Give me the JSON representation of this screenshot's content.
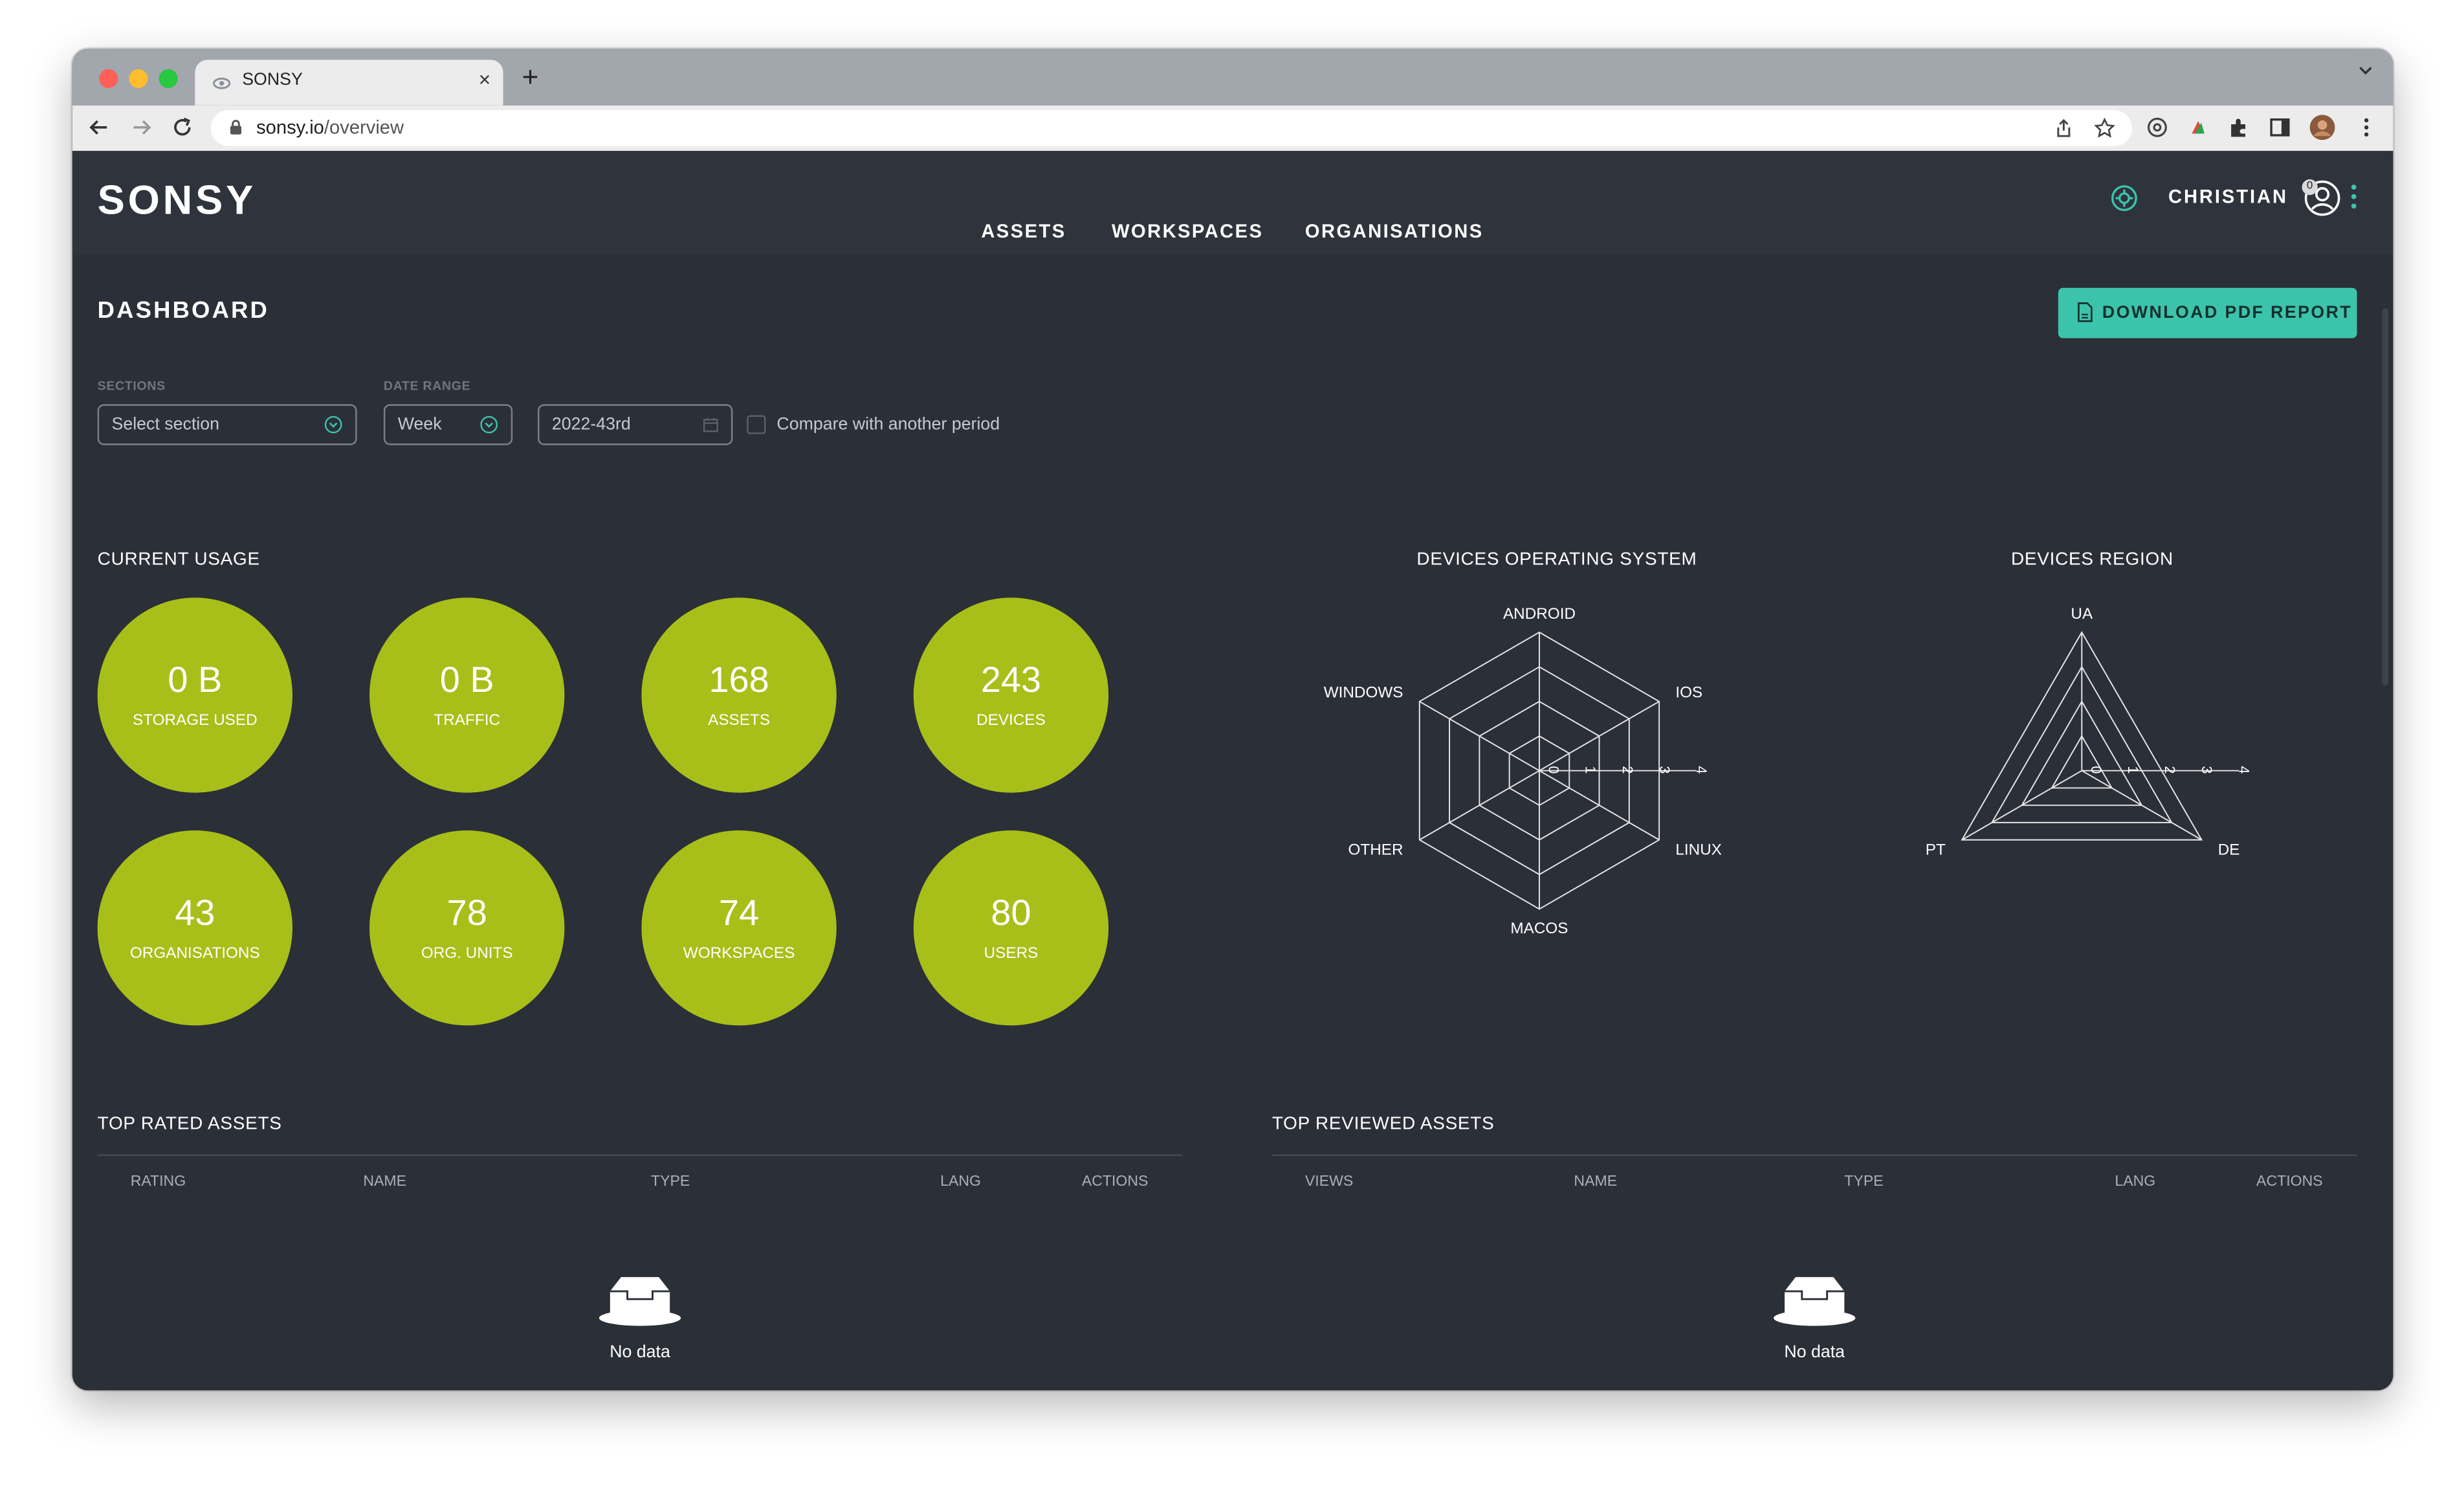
{
  "browser": {
    "tab_title": "SONSY",
    "url_host": "sonsy.io",
    "url_path": "/overview"
  },
  "header": {
    "logo": "SONSY",
    "nav": [
      "ASSETS",
      "WORKSPACES",
      "ORGANISATIONS"
    ],
    "user_name": "CHRISTIAN",
    "notification_count": "0"
  },
  "dashboard": {
    "title": "DASHBOARD",
    "download_label": "DOWNLOAD PDF REPORT"
  },
  "filters": {
    "sections_label": "SECTIONS",
    "sections_value": "Select section",
    "date_range_label": "DATE RANGE",
    "period_value": "Week",
    "date_value": "2022-43rd",
    "compare_label": "Compare with another period",
    "compare_checked": false
  },
  "usage": {
    "title": "CURRENT USAGE",
    "tiles": [
      {
        "value": "0 B",
        "label": "STORAGE USED"
      },
      {
        "value": "0 B",
        "label": "TRAFFIC"
      },
      {
        "value": "168",
        "label": "ASSETS"
      },
      {
        "value": "243",
        "label": "DEVICES"
      },
      {
        "value": "43",
        "label": "ORGANISATIONS"
      },
      {
        "value": "78",
        "label": "ORG. UNITS"
      },
      {
        "value": "74",
        "label": "WORKSPACES"
      },
      {
        "value": "80",
        "label": "USERS"
      }
    ],
    "tile_color": "#a8bf19"
  },
  "chart_data": [
    {
      "type": "radar",
      "title": "DEVICES OPERATING SYSTEM",
      "axes": [
        "ANDROID",
        "IOS",
        "LINUX",
        "MACOS",
        "OTHER",
        "WINDOWS"
      ],
      "ticks": [
        "0",
        "1",
        "2",
        "3",
        "4"
      ],
      "range": [
        0,
        4
      ],
      "series": [
        {
          "values": [
            0,
            0,
            0,
            0,
            0,
            0
          ]
        }
      ],
      "grid": true
    },
    {
      "type": "radar",
      "title": "DEVICES REGION",
      "axes": [
        "UA",
        "DE",
        "PT"
      ],
      "ticks": [
        "0",
        "1",
        "2",
        "3",
        "4"
      ],
      "range": [
        0,
        4
      ],
      "series": [
        {
          "values": [
            0,
            0,
            0
          ]
        }
      ],
      "grid": true
    }
  ],
  "top_rated": {
    "title": "TOP RATED ASSETS",
    "columns": [
      "RATING",
      "NAME",
      "TYPE",
      "LANG",
      "ACTIONS"
    ],
    "empty_text": "No data"
  },
  "top_reviewed": {
    "title": "TOP REVIEWED ASSETS",
    "columns": [
      "VIEWS",
      "NAME",
      "TYPE",
      "LANG",
      "ACTIONS"
    ],
    "empty_text": "No data"
  },
  "colors": {
    "background": "#2b2f38",
    "header": "#2f333c",
    "accent": "#3cc3ac",
    "tile": "#a8bf19"
  }
}
